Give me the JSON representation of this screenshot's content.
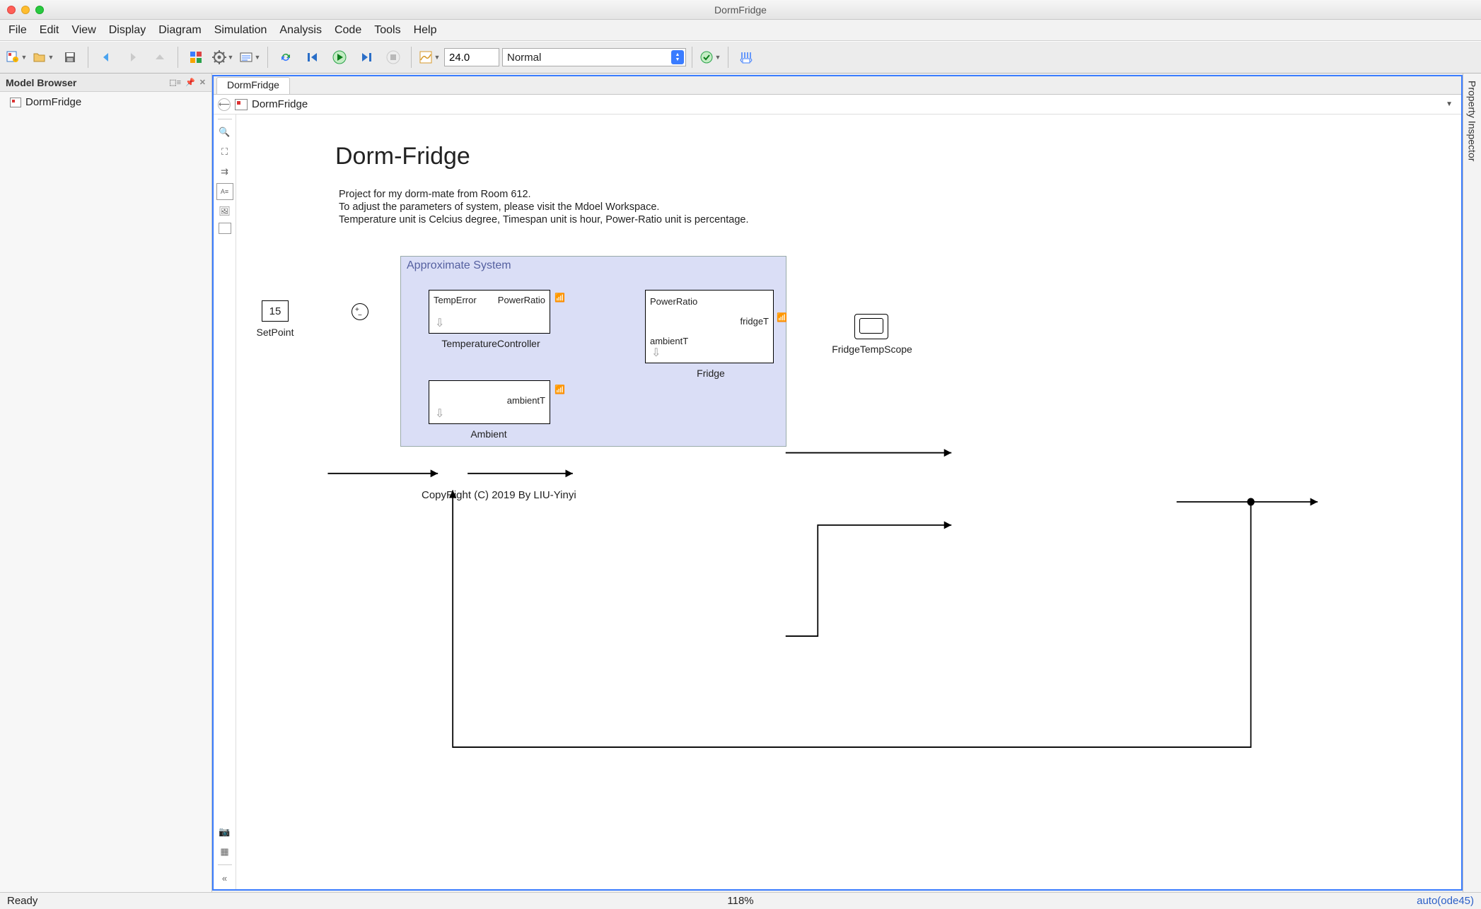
{
  "window": {
    "title": "DormFridge"
  },
  "menus": [
    "File",
    "Edit",
    "View",
    "Display",
    "Diagram",
    "Simulation",
    "Analysis",
    "Code",
    "Tools",
    "Help"
  ],
  "toolbar": {
    "stop_time": "24.0",
    "sim_mode": "Normal"
  },
  "sidebar": {
    "title": "Model Browser",
    "root": "DormFridge"
  },
  "tabs": {
    "active": "DormFridge"
  },
  "breadcrumb": {
    "model": "DormFridge"
  },
  "diagram": {
    "title": "Dorm-Fridge",
    "desc_line1": "Project for my dorm-mate from Room 612.",
    "desc_line2": "To adjust the parameters of system, please visit the Mdoel Workspace.",
    "desc_line3": "Temperature unit is Celcius degree, Timespan unit is hour, Power-Ratio unit is percentage.",
    "area_label": "Approximate System",
    "setpoint_value": "15",
    "setpoint_label": "SetPoint",
    "tc": {
      "in": "TempError",
      "out": "PowerRatio",
      "label": "TemperatureController"
    },
    "ambient": {
      "out": "ambientT",
      "label": "Ambient"
    },
    "fridge": {
      "in1": "PowerRatio",
      "in2": "ambientT",
      "out": "fridgeT",
      "label": "Fridge"
    },
    "scope_label": "FridgeTempScope",
    "copyright": "CopyRight (C) 2019 By LIU-Yinyi"
  },
  "property_inspector": "Property Inspector",
  "status": {
    "ready": "Ready",
    "zoom": "118%",
    "solver": "auto(ode45)"
  }
}
